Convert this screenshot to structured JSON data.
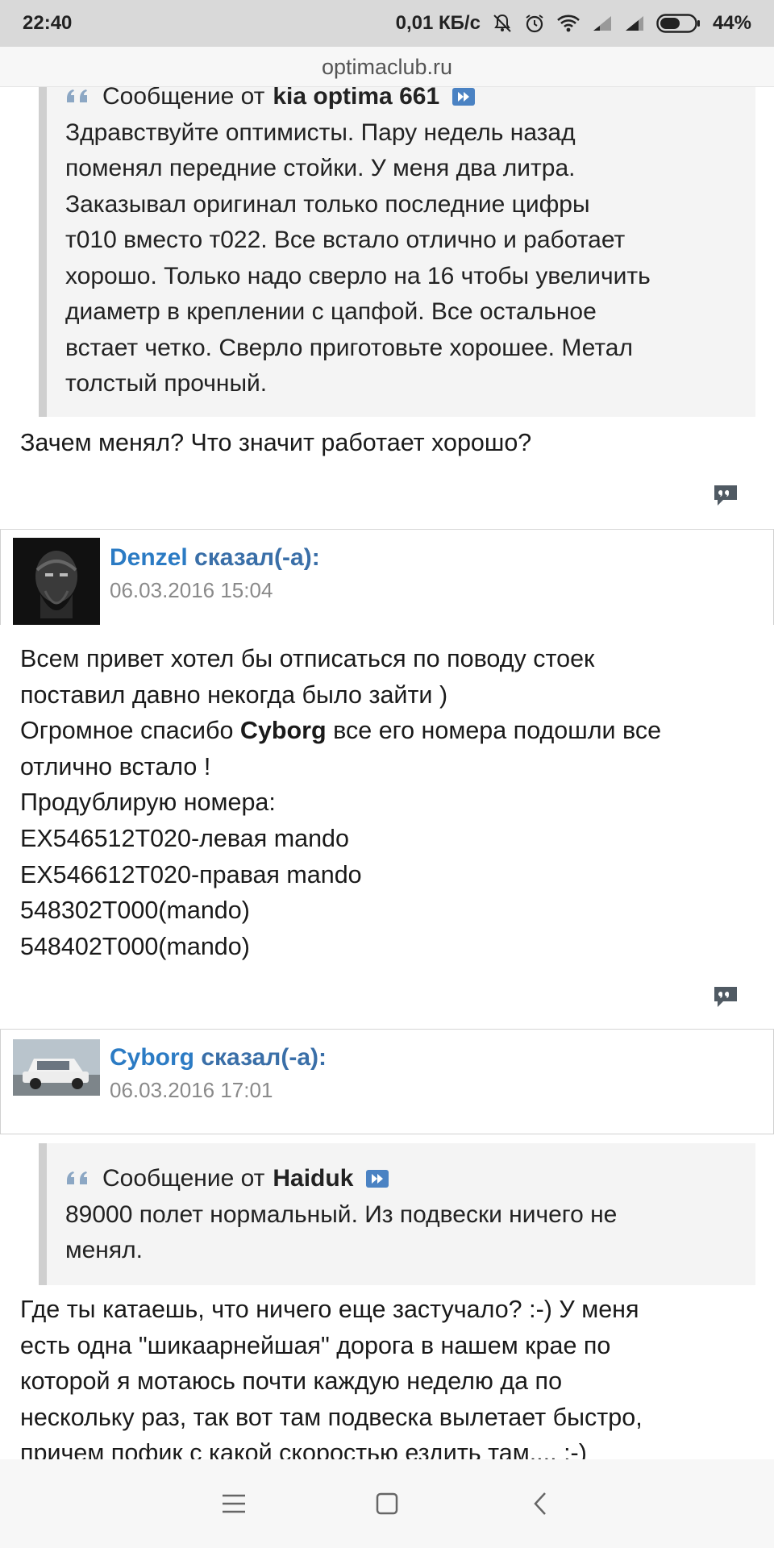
{
  "status_bar": {
    "time": "22:40",
    "net_speed": "0,01 КБ/с",
    "battery": "44%"
  },
  "browser": {
    "domain": "optimaclub.ru"
  },
  "posts": [
    {
      "quote": {
        "prefix": "Сообщение от",
        "author": "kia optima 661",
        "lines": [
          "Здравствуйте оптимисты. Пару недель назад",
          "поменял передние стойки. У меня два литра.",
          "Заказывал оригинал только последние цифры",
          "т010 вместо т022. Все встало отлично и работает",
          "хорошо. Только надо сверло на 16 чтобы увеличить",
          "диаметр в креплении с цапфой. Все остальное",
          "встает четко. Сверло приготовьте хорошее. Метал",
          "толстый прочный."
        ]
      },
      "body": [
        "Зачем менял? Что значит работает хорошо?"
      ]
    },
    {
      "author": "Denzel",
      "said": "сказал(-а):",
      "date": "06.03.2016 15:04",
      "body_parts": [
        "Всем привет хотел бы отписаться по поводу стоек",
        "поставил давно некогда было зайти )",
        "Огромное спасибо ",
        "Cyborg",
        " все его номера подошли все",
        "отлично встало !",
        "Продублирую номера:",
        "EX546512T020-левая mando",
        "EX546612T020-правая mando",
        "548302T000(mando)",
        "548402T000(mando)"
      ]
    },
    {
      "author": "Cyborg",
      "said": "сказал(-а):",
      "date": "06.03.2016 17:01",
      "quote": {
        "prefix": "Сообщение от",
        "author": "Haiduk",
        "lines": [
          "89000 полет нормальный. Из подвески ничего не",
          "менял."
        ]
      },
      "body": [
        "Где ты катаешь, что ничего еще застучало? :-) У меня",
        "есть одна \"шикаарнейшая\" дорога в нашем крае по",
        "которой я мотаюсь почти каждую неделю да по",
        "нескольку раз, так вот там подвеска вылетает быстро,",
        "причем пофик с какой скоростью ездить там.... :-)"
      ]
    }
  ],
  "icons": {
    "quote": "quote-icon",
    "jump": "go-to-post-icon",
    "reply": "reply-quote-icon",
    "menu": "menu-icon",
    "home": "home-icon",
    "back": "back-icon"
  },
  "colors": {
    "link_blue": "#2b7bc4",
    "status_bar_bg": "#d9d9d9",
    "quote_bg": "#f4f4f4",
    "quote_border": "#cfcfcf"
  }
}
